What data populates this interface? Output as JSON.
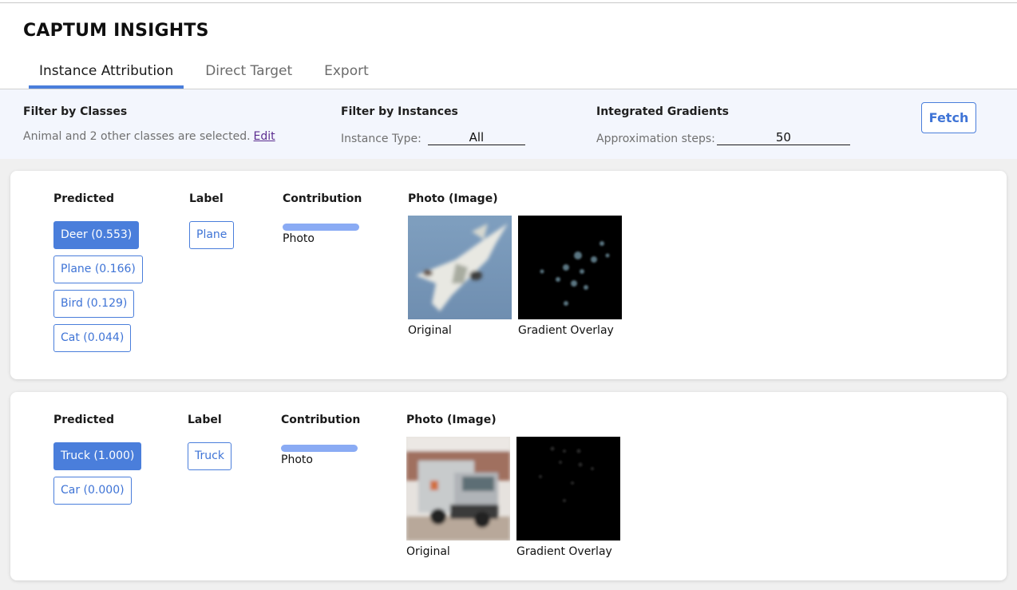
{
  "app": {
    "title": "CAPTUM INSIGHTS",
    "tabs": [
      {
        "label": "Instance Attribution",
        "active": true
      },
      {
        "label": "Direct Target",
        "active": false
      },
      {
        "label": "Export",
        "active": false
      }
    ]
  },
  "filters": {
    "classes": {
      "title": "Filter by Classes",
      "summary": "Animal and 2 other classes are selected.",
      "edit_label": "Edit"
    },
    "instances": {
      "title": "Filter by Instances",
      "label": "Instance Type:",
      "value": "All"
    },
    "method": {
      "title": "Integrated Gradients",
      "label": "Approximation steps:",
      "value": "50"
    },
    "fetch_label": "Fetch"
  },
  "colors": {
    "accent": "#4a7edb",
    "contribution_bar": "#8aabf4",
    "filter_bar_bg": "#f3f6fd",
    "edit_link": "#5b2c8f"
  },
  "column_headers": {
    "predicted": "Predicted",
    "label": "Label",
    "contribution": "Contribution",
    "photo": "Photo (Image)"
  },
  "instances": [
    {
      "predicted": [
        {
          "label": "Deer (0.553)",
          "primary": true
        },
        {
          "label": "Plane (0.166)",
          "primary": false
        },
        {
          "label": "Bird (0.129)",
          "primary": false
        },
        {
          "label": "Cat (0.044)",
          "primary": false
        }
      ],
      "true_label": "Plane",
      "contribution": {
        "name": "Photo",
        "value": 1.0
      },
      "images": {
        "original_caption": "Original",
        "overlay_caption": "Gradient Overlay",
        "subject": "fighter jet"
      }
    },
    {
      "predicted": [
        {
          "label": "Truck (1.000)",
          "primary": true
        },
        {
          "label": "Car (0.000)",
          "primary": false
        }
      ],
      "true_label": "Truck",
      "contribution": {
        "name": "Photo",
        "value": 1.0
      },
      "images": {
        "original_caption": "Original",
        "overlay_caption": "Gradient Overlay",
        "subject": "truck"
      }
    }
  ]
}
